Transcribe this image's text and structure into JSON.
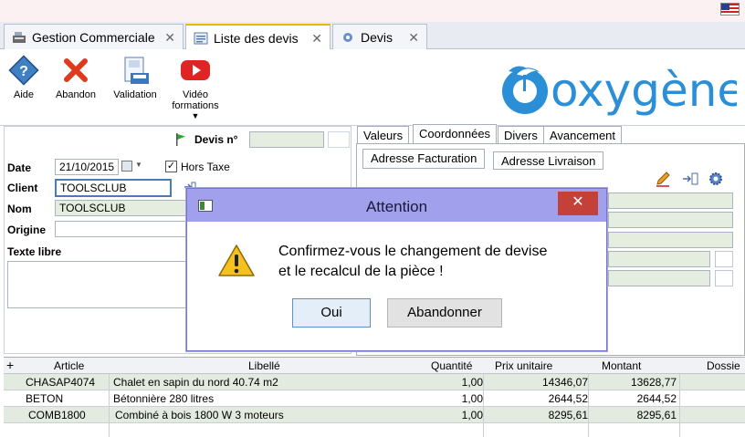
{
  "tabs": [
    {
      "label": "Gestion Commerciale",
      "icon": "cash-register-icon"
    },
    {
      "label": "Liste des devis",
      "icon": "list-document-icon"
    },
    {
      "label": "Devis",
      "icon": "gear-document-icon"
    }
  ],
  "toolbar": {
    "aide": "Aide",
    "abandon": "Abandon",
    "validation": "Validation",
    "video_line1": "Vidéo",
    "video_line2": "formations",
    "logo_text": "oxygène"
  },
  "form": {
    "devis_label": "Devis n°",
    "date_label": "Date",
    "date_value": "21/10/2015",
    "hors_taxe_label": "Hors Taxe",
    "hors_taxe_checked": true,
    "client_label": "Client",
    "client_value": "TOOLSCLUB",
    "nom_label": "Nom",
    "nom_value": "TOOLSCLUB",
    "origine_label": "Origine",
    "texte_libre_label": "Texte libre"
  },
  "right_tabs": [
    "Valeurs",
    "Coordonnées",
    "Divers",
    "Avancement"
  ],
  "sub_tabs": [
    "Adresse Facturation",
    "Adresse Livraison"
  ],
  "grid": {
    "headers": [
      "Article",
      "Libellé",
      "Quantité",
      "Prix unitaire",
      "Montant",
      "Dossie"
    ],
    "rows": [
      {
        "article": "CHASAP4074",
        "libelle": "Chalet en sapin du nord 40.74 m2",
        "quantite": "1,00",
        "prix": "14346,07",
        "montant": "13628,77"
      },
      {
        "article": "BETON",
        "libelle": "Bétonnière 280 litres",
        "quantite": "1,00",
        "prix": "2644,52",
        "montant": "2644,52"
      },
      {
        "article": "COMB1800",
        "libelle": "Combiné à bois 1800 W 3 moteurs",
        "quantite": "1,00",
        "prix": "8295,61",
        "montant": "8295,61"
      }
    ]
  },
  "dialog": {
    "title": "Attention",
    "close": "✕",
    "message_line1": "Confirmez-vous le changement de devise",
    "message_line2": "et le recalcul de la pièce !",
    "oui": "Oui",
    "abandonner": "Abandonner"
  },
  "colors": {
    "dialog_title_bg": "#a0a0ec",
    "dialog_close_bg": "#c4413a",
    "logo_blue": "#2a8fd6",
    "grey_field": "#e5ece0"
  }
}
